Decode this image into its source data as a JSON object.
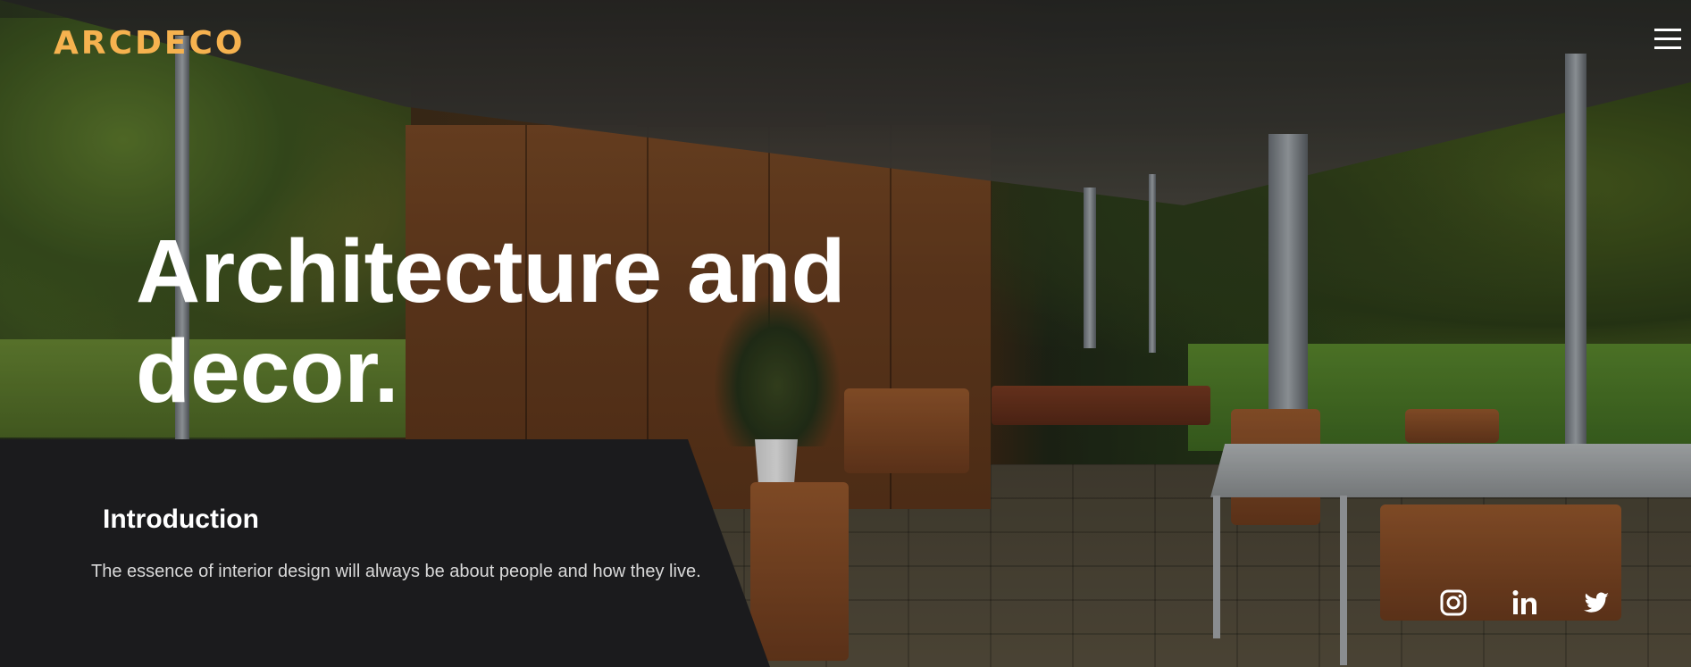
{
  "brand": {
    "logo_text": "ARCDECO",
    "accent_color": "#f6b24f"
  },
  "header": {
    "menu_icon": "hamburger-menu-icon"
  },
  "hero": {
    "title_line1": "Architecture and",
    "title_line2": "decor."
  },
  "intro": {
    "title": "Introduction",
    "text": "The essence of interior design will always be about people and how they live."
  },
  "social": [
    {
      "name": "instagram",
      "icon": "instagram-icon"
    },
    {
      "name": "linkedin",
      "icon": "linkedin-icon"
    },
    {
      "name": "twitter",
      "icon": "twitter-icon"
    }
  ]
}
